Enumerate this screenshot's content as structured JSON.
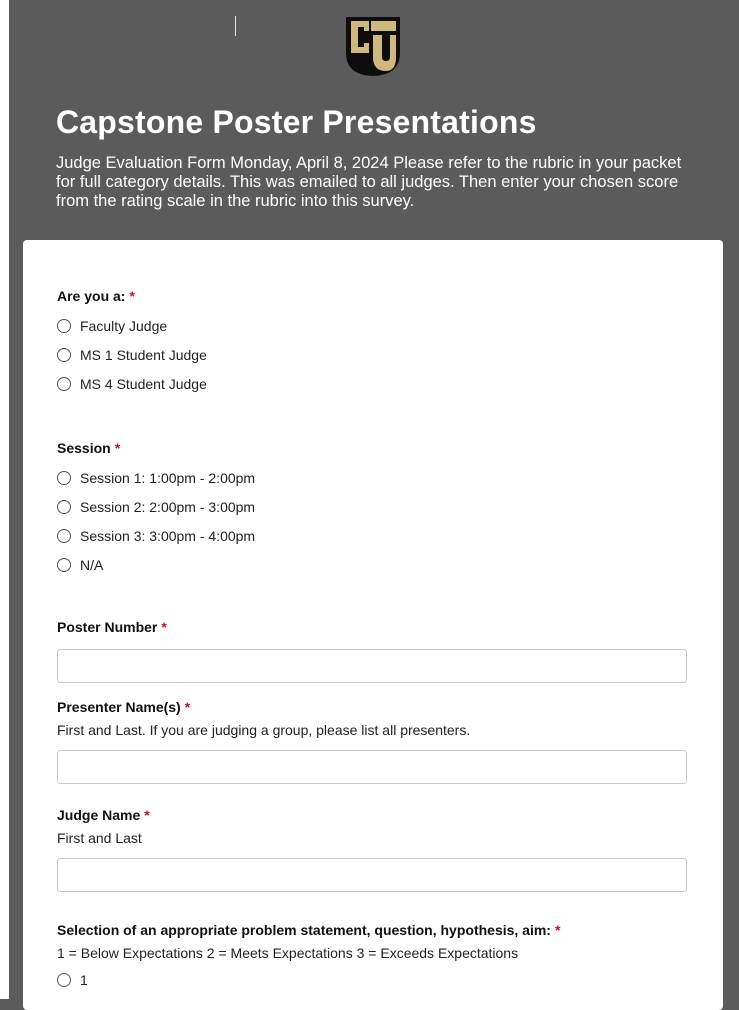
{
  "header": {
    "title": "Capstone Poster Presentations",
    "description": "Judge Evaluation Form Monday, April 8, 2024 Please refer to the rubric in your packet for full category details. This was emailed to all judges. Then enter your chosen score from the rating scale in the rubric into this survey.",
    "logo_icon": "cu-logo-icon",
    "colors": {
      "header_bg": "#5b5b5b",
      "logo_gold": "#cfb87c",
      "required": "#c8102e"
    }
  },
  "form": {
    "required_marker": "*",
    "role": {
      "label": "Are you a:",
      "options": [
        "Faculty Judge",
        "MS 1 Student Judge",
        "MS 4 Student Judge"
      ]
    },
    "session": {
      "label": "Session",
      "options": [
        "Session 1: 1:00pm - 2:00pm",
        "Session 2: 2:00pm - 3:00pm",
        "Session 3: 3:00pm - 4:00pm",
        "N/A"
      ]
    },
    "poster_number": {
      "label": "Poster Number",
      "value": ""
    },
    "presenter_names": {
      "label": "Presenter Name(s)",
      "help": "First and Last. If you are judging a group, please list all presenters.",
      "value": ""
    },
    "judge_name": {
      "label": "Judge Name",
      "help": "First and Last",
      "value": ""
    },
    "problem_statement": {
      "label": "Selection of an appropriate problem statement, question, hypothesis, aim:",
      "help": "1 = Below Expectations 2 = Meets Expectations 3 = Exceeds Expectations",
      "options": [
        "1"
      ]
    }
  }
}
